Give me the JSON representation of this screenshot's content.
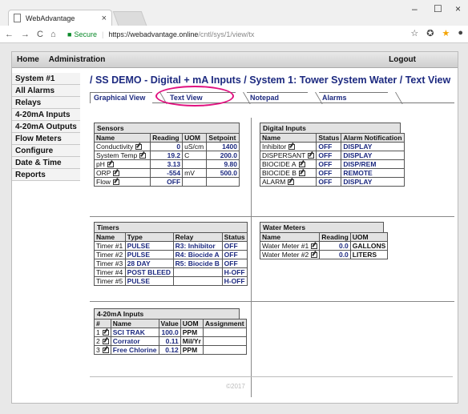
{
  "browser": {
    "tab_title": "WebAdvantage",
    "tab_close": "×",
    "win_min": "–",
    "win_max": "☐",
    "win_close": "×",
    "secure_label": "Secure",
    "url_host": "https://webadvantage.online",
    "url_path": "/cntl/sys/1/view/tx"
  },
  "topnav": {
    "home": "Home",
    "admin": "Administration",
    "logout": "Logout"
  },
  "sidebar": {
    "items": [
      {
        "label": "System #1"
      },
      {
        "label": "All Alarms"
      },
      {
        "label": "Relays"
      },
      {
        "label": "4-20mA Inputs"
      },
      {
        "label": "4-20mA Outputs"
      },
      {
        "label": "Flow Meters"
      },
      {
        "label": "Configure"
      },
      {
        "label": "Date & Time"
      },
      {
        "label": "Reports"
      }
    ]
  },
  "breadcrumb": "/ SS DEMO - Digital + mA Inputs / System 1: Tower System Water  / Text View",
  "tabs": {
    "graphical": "Graphical View",
    "text": "Text View",
    "notepad": "Notepad",
    "alarms": "Alarms"
  },
  "sensors": {
    "title": "Sensors",
    "headers": [
      "Name",
      "Reading",
      "UOM",
      "Setpoint"
    ],
    "rows": [
      {
        "name": "Conductivity",
        "reading": "0",
        "uom": "uS/cm",
        "setpoint": "1400"
      },
      {
        "name": "System Temp",
        "reading": "19.2",
        "uom": "C",
        "setpoint": "200.0"
      },
      {
        "name": "pH",
        "reading": "3.13",
        "uom": "",
        "setpoint": "9.80"
      },
      {
        "name": "ORP",
        "reading": "-554",
        "uom": "mV",
        "setpoint": "500.0"
      },
      {
        "name": "Flow",
        "reading": "OFF",
        "uom": "",
        "setpoint": ""
      }
    ]
  },
  "digital": {
    "title": "Digital Inputs",
    "headers": [
      "Name",
      "Status",
      "Alarm Notification"
    ],
    "rows": [
      {
        "name": "Inhibitor",
        "status": "OFF",
        "alarm": "DISPLAY"
      },
      {
        "name": "DISPERSANT",
        "status": "OFF",
        "alarm": "DISPLAY"
      },
      {
        "name": "BIOCIDE A",
        "status": "OFF",
        "alarm": "DISP/REM"
      },
      {
        "name": "BIOCIDE B",
        "status": "OFF",
        "alarm": "REMOTE"
      },
      {
        "name": "ALARM",
        "status": "OFF",
        "alarm": "DISPLAY"
      }
    ]
  },
  "timers": {
    "title": "Timers",
    "headers": [
      "Name",
      "Type",
      "Relay",
      "Status"
    ],
    "rows": [
      {
        "name": "Timer #1",
        "type": "PULSE",
        "relay": "R3: Inhibitor",
        "status": "OFF"
      },
      {
        "name": "Timer #2",
        "type": "PULSE",
        "relay": "R4: Biocide A",
        "status": "OFF"
      },
      {
        "name": "Timer #3",
        "type": "28 DAY",
        "relay": "R5: Biocide B",
        "status": "OFF"
      },
      {
        "name": "Timer #4",
        "type": "POST BLEED",
        "relay": "",
        "status": "H-OFF"
      },
      {
        "name": "Timer #5",
        "type": "PULSE",
        "relay": "",
        "status": "H-OFF"
      }
    ]
  },
  "meters": {
    "title": "Water Meters",
    "headers": [
      "Name",
      "Reading",
      "UOM"
    ],
    "rows": [
      {
        "name": "Water Meter #1",
        "reading": "0.0",
        "uom": "GALLONS"
      },
      {
        "name": "Water Meter #2",
        "reading": "0.0",
        "uom": "LITERS"
      }
    ]
  },
  "ma": {
    "title": "4-20mA Inputs",
    "headers": [
      "#",
      "Name",
      "Value",
      "UOM",
      "Assignment"
    ],
    "rows": [
      {
        "num": "1",
        "name": "SCI TRAK",
        "value": "100.0",
        "uom": "PPM",
        "assign": ""
      },
      {
        "num": "2",
        "name": "Corrator",
        "value": "0.11",
        "uom": "Mil/Yr",
        "assign": ""
      },
      {
        "num": "3",
        "name": "Free Chlorine",
        "value": "0.12",
        "uom": "PPM",
        "assign": ""
      }
    ]
  },
  "footer": "©2017",
  "colors": {
    "accent": "#1d2a80",
    "highlight": "#e0107f",
    "secure": "#0a8a2a"
  }
}
